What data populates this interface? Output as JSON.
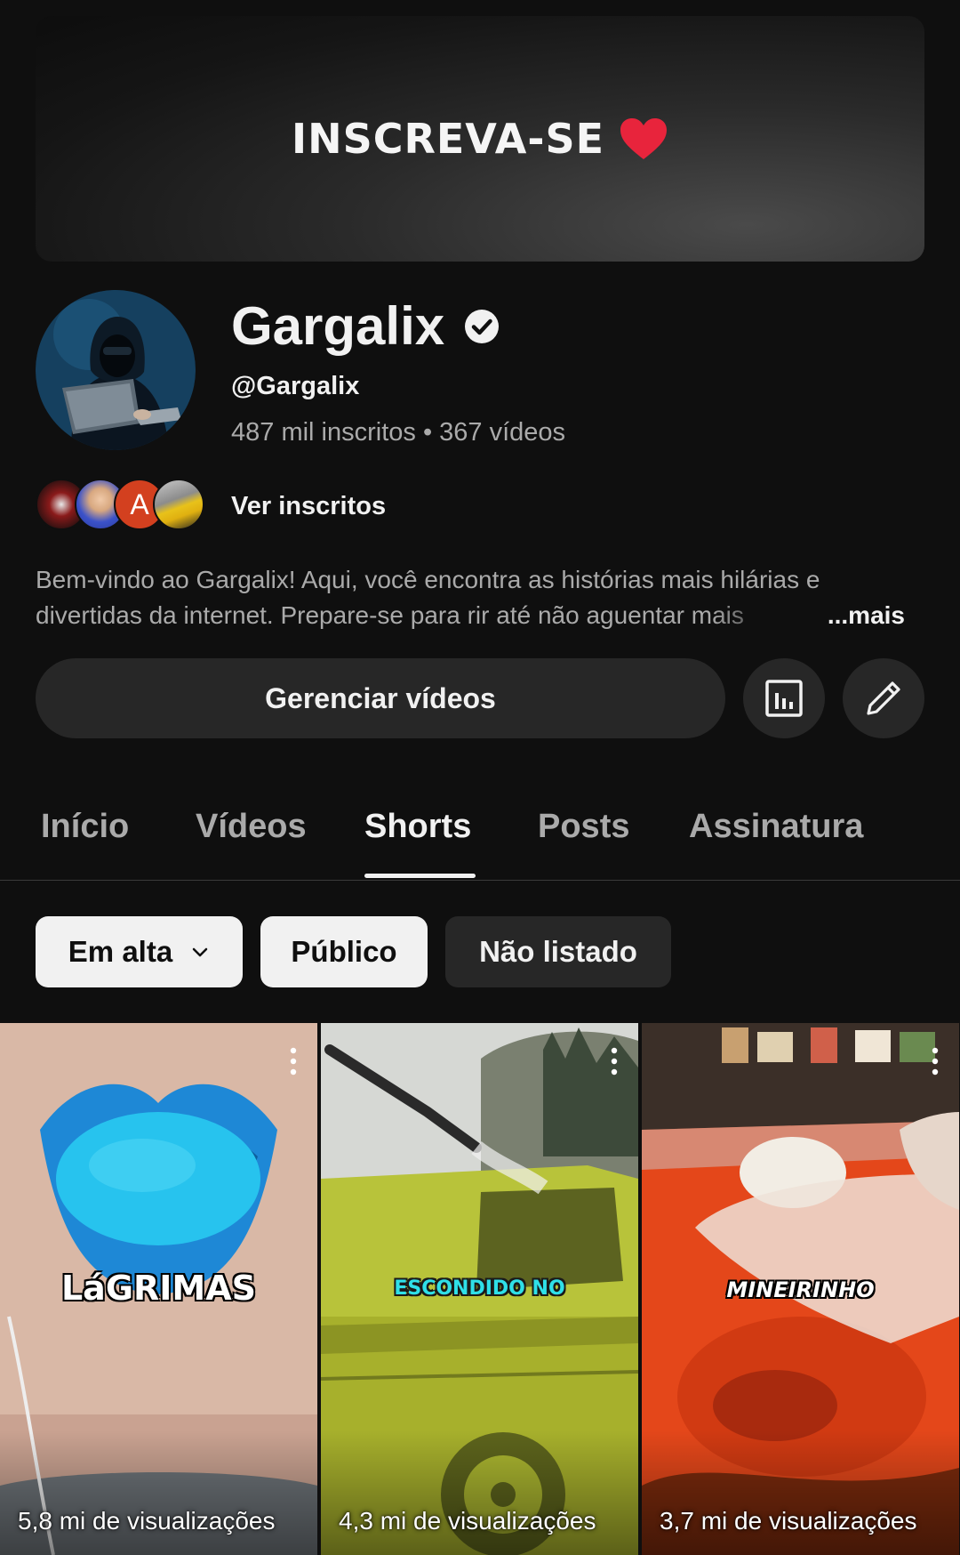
{
  "banner": {
    "text": "INSCREVA-SE",
    "heart_color": "#e8243c"
  },
  "channel": {
    "name": "Gargalix",
    "handle": "@Gargalix",
    "stats": "487 mil inscritos • 367 vídeos",
    "subscribers_link": "Ver inscritos",
    "subscriber_avatar_letter": "A",
    "description_line1": "Bem-vindo ao Gargalix! Aqui, você encontra as histórias mais hilárias e",
    "description_line2": "divertidas da internet. Prepare-se para rir até não aguentar mais",
    "description_more": "...mais"
  },
  "actions": {
    "manage_label": "Gerenciar vídeos",
    "analytics_icon": "analytics-icon",
    "edit_icon": "pencil-icon"
  },
  "tabs": [
    {
      "label": "Início"
    },
    {
      "label": "Vídeos"
    },
    {
      "label": "Shorts",
      "active": true
    },
    {
      "label": "Posts"
    },
    {
      "label": "Assinatura"
    }
  ],
  "filters": {
    "sort_label": "Em alta",
    "public_label": "Público",
    "unlisted_label": "Não listado"
  },
  "shorts": [
    {
      "title": "LáGRIMAS",
      "views": "5,8 mi de visualizações"
    },
    {
      "title": "ESCONDIDO NO",
      "views": "4,3 mi de visualizações"
    },
    {
      "title": "MINEIRINHO",
      "views": "3,7 mi de visualizações"
    }
  ],
  "colors": {
    "background": "#0f0f0f",
    "surface": "#272727",
    "text_primary": "#f1f1f1",
    "text_secondary": "#aaaaaa",
    "chip_light": "#f1f1f1"
  }
}
